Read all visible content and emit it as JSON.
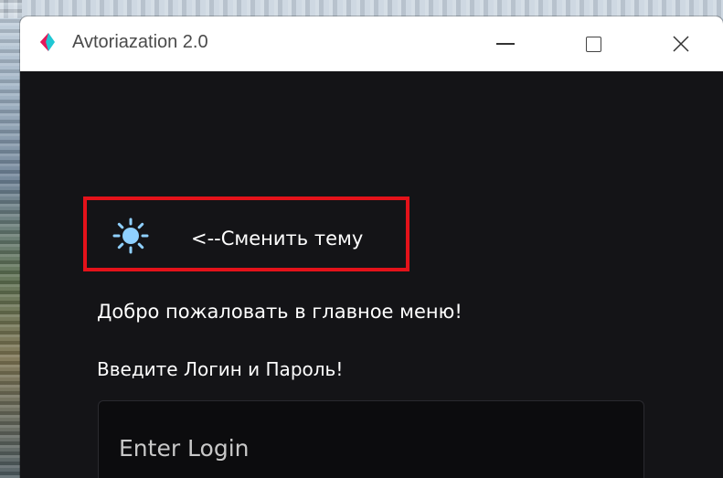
{
  "window": {
    "title": "Avtoriazation 2.0",
    "controls": {
      "minimize": "minimize",
      "maximize": "maximize",
      "close": "close"
    },
    "icon": "app-logo-icon",
    "icon_colors": {
      "left": "#e4185a",
      "right": "#1fc7d4"
    }
  },
  "main": {
    "theme_toggle": {
      "icon": "sun-icon",
      "icon_color": "#8fd0ff",
      "label": "<--Сменить тему",
      "highlight_color": "#e4121a"
    },
    "welcome": "Добро пожаловать в главное меню!",
    "prompt": "Введите Логин и Пароль!",
    "login_field": {
      "placeholder": "Enter Login",
      "value": ""
    }
  },
  "colors": {
    "background": "#141417",
    "text": "#ffffff",
    "titlebar": "#ffffff"
  }
}
